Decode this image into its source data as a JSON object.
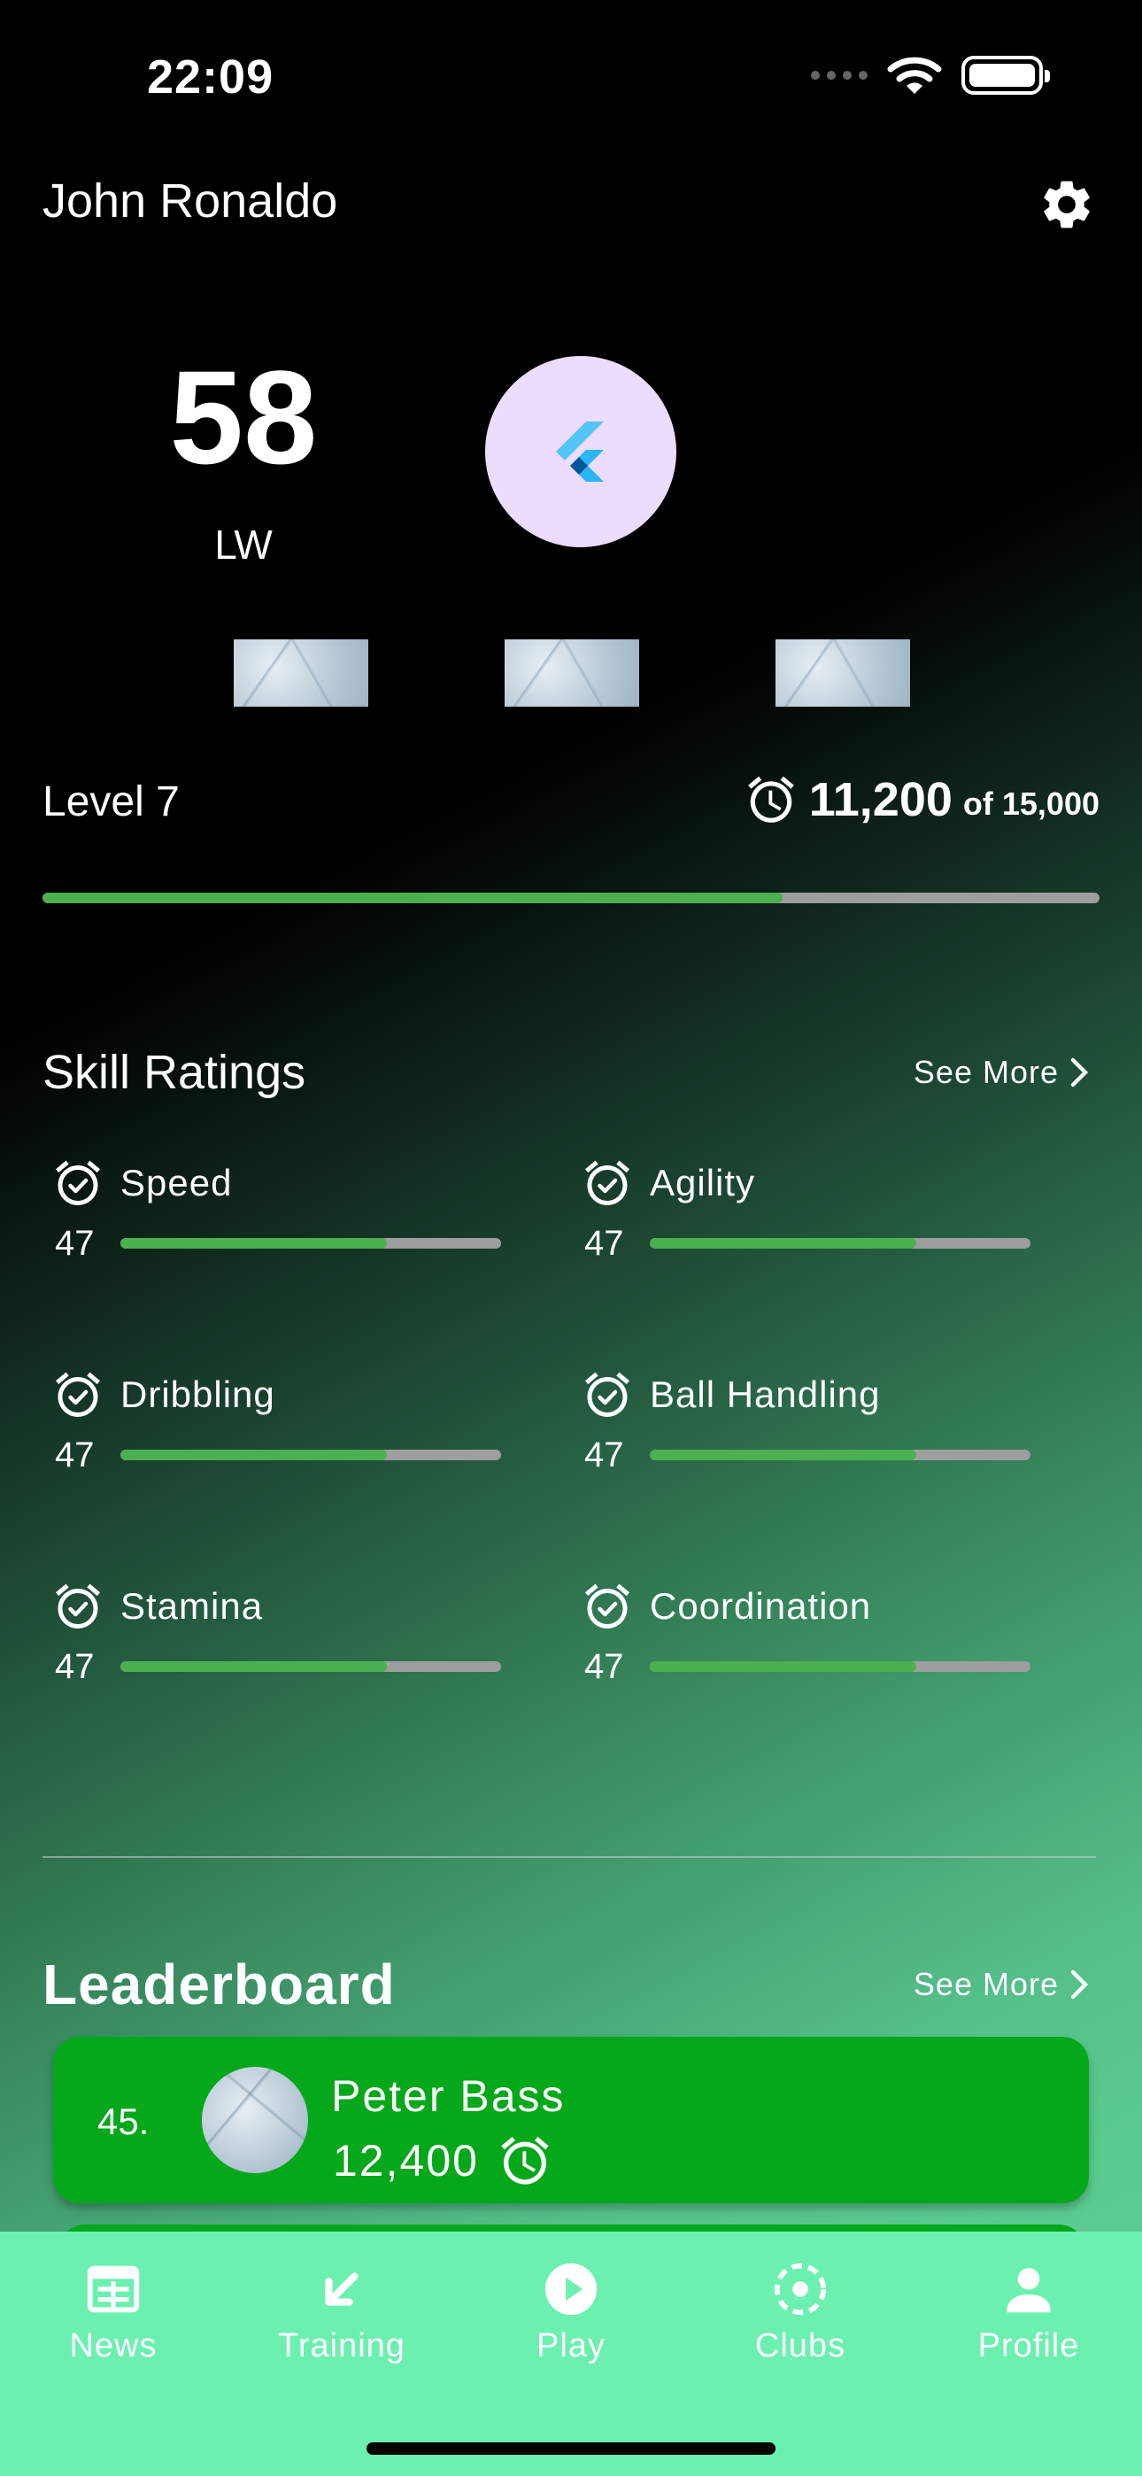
{
  "status_bar": {
    "time": "22:09"
  },
  "header": {
    "player_name": "John Ronaldo"
  },
  "profile": {
    "rating": "58",
    "position": "LW"
  },
  "level": {
    "label": "Level 7",
    "xp_current": "11,200",
    "xp_total_label": "of 15,000",
    "progress": 0.7
  },
  "skills": {
    "title": "Skill Ratings",
    "see_more": "See More",
    "items": [
      {
        "name": "Speed",
        "value": "47",
        "progress": 0.7
      },
      {
        "name": "Agility",
        "value": "47",
        "progress": 0.7
      },
      {
        "name": "Dribbling",
        "value": "47",
        "progress": 0.7
      },
      {
        "name": "Ball Handling",
        "value": "47",
        "progress": 0.7
      },
      {
        "name": "Stamina",
        "value": "47",
        "progress": 0.7
      },
      {
        "name": "Coordination",
        "value": "47",
        "progress": 0.7
      }
    ]
  },
  "leaderboard": {
    "title": "Leaderboard",
    "see_more": "See More",
    "entries": [
      {
        "rank": "45.",
        "name": "Peter Bass",
        "score": "12,400"
      }
    ]
  },
  "bottom_nav": {
    "items": [
      {
        "label": "News",
        "icon": "news-icon"
      },
      {
        "label": "Training",
        "icon": "training-icon"
      },
      {
        "label": "Play",
        "icon": "play-icon"
      },
      {
        "label": "Clubs",
        "icon": "clubs-icon"
      },
      {
        "label": "Profile",
        "icon": "profile-icon"
      }
    ]
  },
  "colors": {
    "progress_fill": "#4caf50",
    "progress_track": "#9e9e9e",
    "card_green": "#06a81b",
    "nav_background": "#6cf0b0",
    "avatar_bg": "#ecdcfd"
  }
}
